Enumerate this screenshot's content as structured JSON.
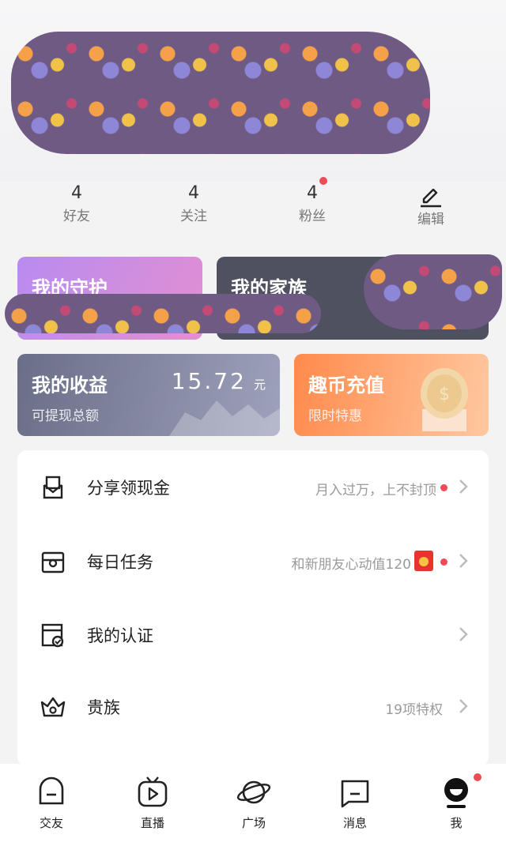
{
  "stats": [
    {
      "value": "4",
      "label": "好友"
    },
    {
      "value": "4",
      "label": "关注"
    },
    {
      "value": "4",
      "label": "粉丝"
    },
    {
      "value": "",
      "label": "编辑"
    }
  ],
  "cards": {
    "guard": {
      "title": "我的守护"
    },
    "family": {
      "title": "我的家族"
    },
    "earnings": {
      "title": "我的收益",
      "amount": "15.72",
      "unit": "元",
      "sub": "可提现总额"
    },
    "recharge": {
      "title": "趣币充值",
      "sub": "限时特惠"
    }
  },
  "list": [
    {
      "label": "分享领现金",
      "hint": "月入过万，上不封顶",
      "icon": "envelope-icon"
    },
    {
      "label": "每日任务",
      "hint": "和新朋友心动值120",
      "icon": "task-icon"
    },
    {
      "label": "我的认证",
      "hint": "",
      "icon": "certificate-icon"
    },
    {
      "label": "贵族",
      "hint": "19项特权",
      "icon": "crown-icon"
    }
  ],
  "tabs": [
    {
      "label": "交友",
      "icon": "chat-face-icon"
    },
    {
      "label": "直播",
      "icon": "tv-play-icon"
    },
    {
      "label": "广场",
      "icon": "planet-icon"
    },
    {
      "label": "消息",
      "icon": "message-icon"
    },
    {
      "label": "我",
      "icon": "profile-icon"
    }
  ],
  "colors": {
    "accent_red": "#ef4b56",
    "red_packet": "#e8342f"
  }
}
